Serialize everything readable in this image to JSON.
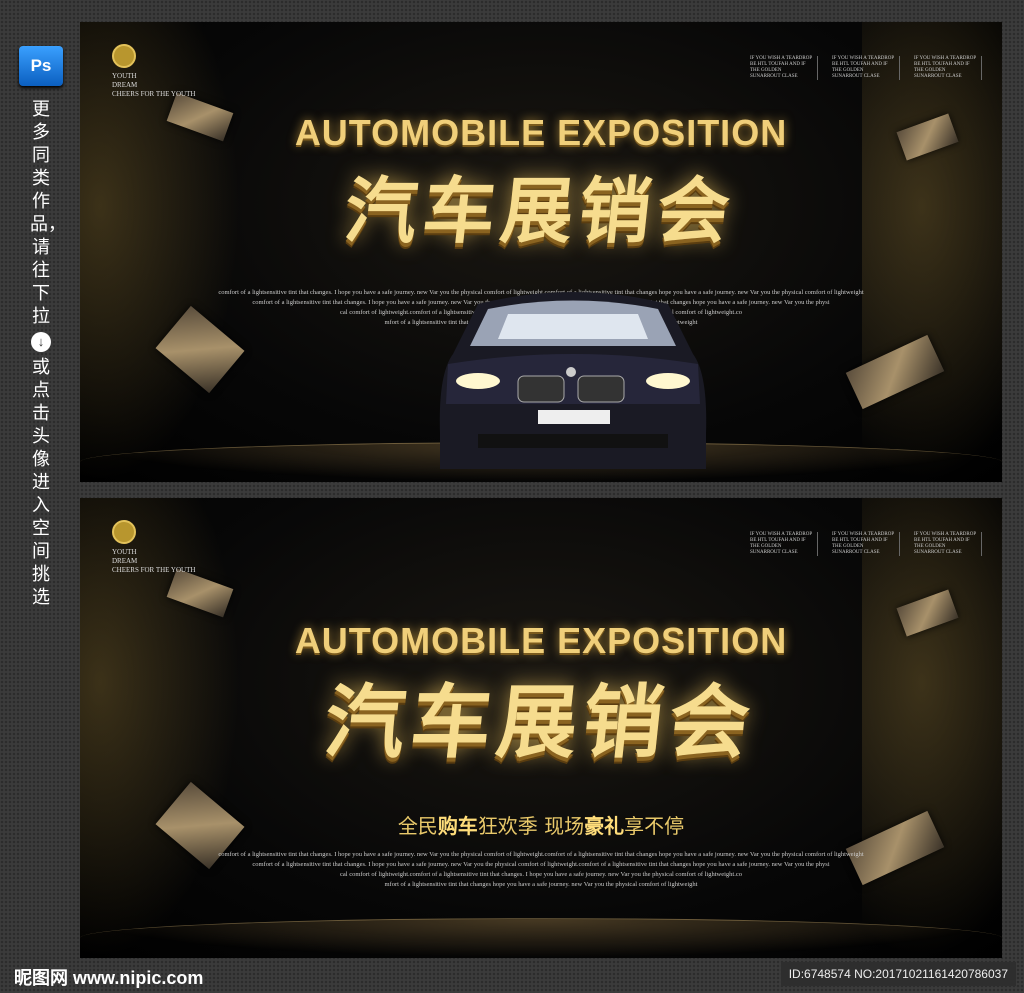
{
  "sidebar": {
    "ps_label": "Ps",
    "text_top": "更多同类作品，请往下拉",
    "text_bottom": "或点击头像进入空间挑选",
    "down_icon": "↓"
  },
  "poster": {
    "tagline": [
      "YOUTH",
      "DREAM",
      "CHEERS FOR THE YOUTH"
    ],
    "corner_text": "IF YOU WISH A TEARDROP BE HTL TOUFAH AND IF THE GOLDEN SUNARROUT CLASE",
    "title_en": "AUTOMOBILE EXPOSITION",
    "title_cn": "汽车展销会",
    "subtitle_pre": "全民",
    "subtitle_b1": "购车",
    "subtitle_mid": "狂欢季  现场",
    "subtitle_b2": "豪礼",
    "subtitle_post": "享不停",
    "body_lines": [
      "comfort of a lightsensitive tint that changes. I hope you have a safe journey. new Var you the physical comfort of lightweight.comfort of a lightsensitive tint that changes hope you have a safe journey. new Var you the physical comfort of lightweight",
      "comfort of a lightsensitive tint that changes. I hope you have a safe journey. new Var you the physical comfort of lightweight.comfort of a lightsensitive tint that changes hope you have a safe journey. new Var you the physi",
      "cal comfort of lightweight.comfort of a lightsensitive tint that changes. I hope you have a safe journey. new Var you the physical comfort of lightweight.co",
      "mfort of a lightsensitive tint that changes hope you have a safe journey. new Var you the physical comfort of lightweight"
    ]
  },
  "footer": {
    "logo": "昵图网 www.nipic.com",
    "id": "ID:6748574 NO:20171021161420786037"
  }
}
